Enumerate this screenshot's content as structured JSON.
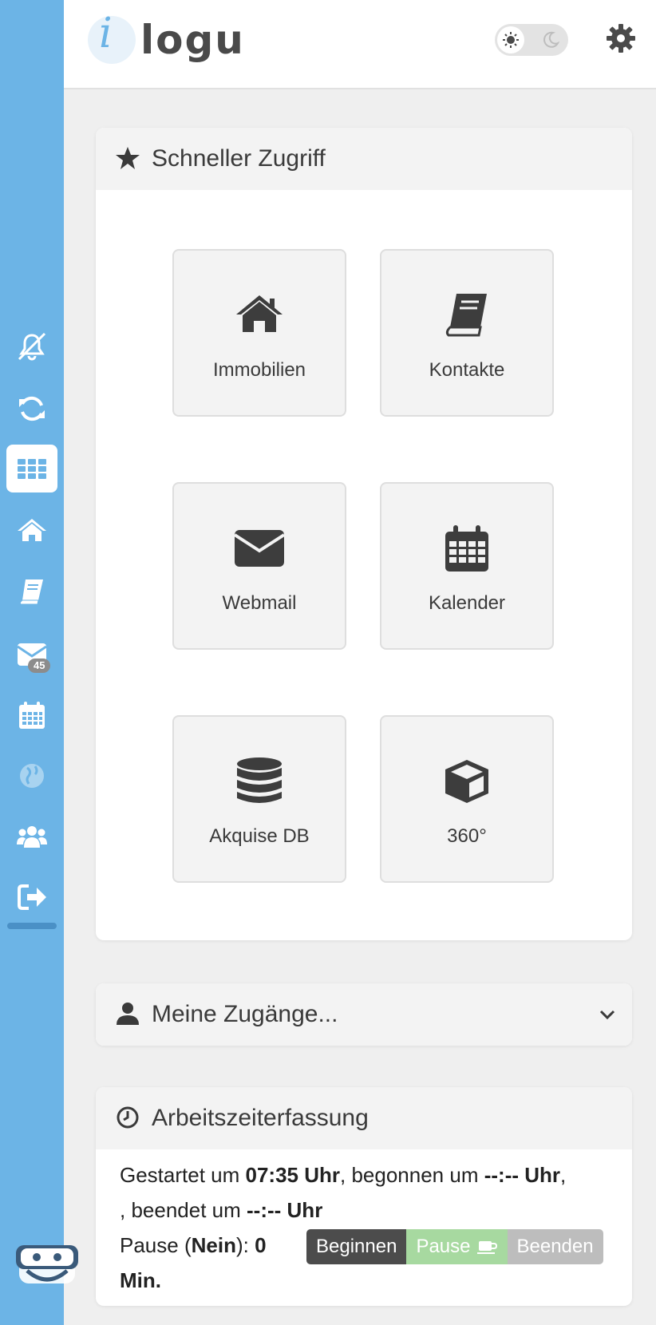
{
  "header": {
    "logo_i": "i",
    "logo_text": "logu"
  },
  "sidebar": {
    "items": [
      {
        "name": "notifications-off",
        "icon": "bell-slash-icon"
      },
      {
        "name": "sync",
        "icon": "sync-icon"
      },
      {
        "name": "dashboard",
        "icon": "grid-icon",
        "active": true
      },
      {
        "name": "properties",
        "icon": "home-icon"
      },
      {
        "name": "contacts",
        "icon": "book-icon"
      },
      {
        "name": "mail",
        "icon": "envelope-icon",
        "badge": "45"
      },
      {
        "name": "calendar",
        "icon": "calendar-icon"
      },
      {
        "name": "web",
        "icon": "globe-icon"
      },
      {
        "name": "team",
        "icon": "users-icon"
      },
      {
        "name": "logout",
        "icon": "sign-out-icon"
      }
    ]
  },
  "quick_access": {
    "title": "Schneller Zugriff",
    "tiles": [
      {
        "label": "Immobilien",
        "icon": "home-icon"
      },
      {
        "label": "Kontakte",
        "icon": "book-icon"
      },
      {
        "label": "Webmail",
        "icon": "envelope-icon"
      },
      {
        "label": "Kalender",
        "icon": "calendar-icon"
      },
      {
        "label": "Akquise DB",
        "icon": "database-icon"
      },
      {
        "label": "360°",
        "icon": "cube-icon"
      }
    ]
  },
  "accounts": {
    "title": "Meine Zugänge..."
  },
  "time_tracking": {
    "title": "Arbeitszeiterfassung",
    "started_label": "Gestartet um",
    "started_time": "07:35 Uhr",
    "begun_label": ", begonnen um",
    "begun_time": "--:-- Uhr",
    "ended_label": ", beendet um",
    "ended_time": "--:-- Uhr",
    "pause_label": "Pause (",
    "pause_state": "Nein",
    "pause_sep": "):",
    "pause_minutes": "0 Min.",
    "buttons": {
      "begin": "Beginnen",
      "pause": "Pause",
      "end": "Beenden"
    }
  },
  "colors": {
    "sidebar": "#6cb4e6",
    "begin_button": "#4c4c4c",
    "pause_button": "#a7d9a0",
    "end_button": "#bdbdbd"
  }
}
